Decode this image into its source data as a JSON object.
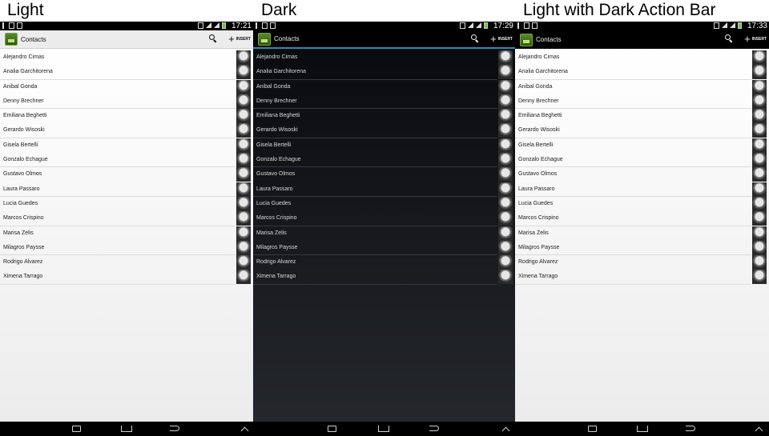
{
  "panels": [
    {
      "caption": "Light",
      "theme": "light",
      "status_time": "17:21",
      "app_title": "Contacts",
      "insert_label": "INSERT",
      "search_icon": "search-icon",
      "contacts": [
        "Alejandro Cimas",
        "Analia Garchitorena",
        "Anibal Gonda",
        "Denny Brechner",
        "Emiliana Beghetti",
        "Gerardo Wisoski",
        "Gisela Bertelli",
        "Gonzalo Echague",
        "Gustavo Olmos",
        "Laura Passaro",
        "Lucia Guedes",
        "Marcos Crispino",
        "Marisa Zelis",
        "Milagros Paysse",
        "Rodrigo Alvarez",
        "Ximena Tarrago"
      ]
    },
    {
      "caption": "Dark",
      "theme": "dark",
      "status_time": "17:29",
      "app_title": "Contacts",
      "insert_label": "INSERT",
      "search_icon": "search-icon",
      "contacts": [
        "Alejandro Cimas",
        "Analia Garchitorena",
        "Anibal Gonda",
        "Denny Brechner",
        "Emiliana Beghetti",
        "Gerardo Wisoski",
        "Gisela Bertelli",
        "Gonzalo Echague",
        "Gustavo Olmos",
        "Laura Passaro",
        "Lucia Guedes",
        "Marcos Crispino",
        "Marisa Zelis",
        "Milagros Paysse",
        "Rodrigo Alvarez",
        "Ximena Tarrago"
      ]
    },
    {
      "caption": "Light with Dark Action Bar",
      "theme": "mixed",
      "status_time": "17:33",
      "app_title": "Contacts",
      "insert_label": "INSERT",
      "search_icon": "search-icon",
      "contacts": [
        "Alejandro Cimas",
        "Analia Garchitorena",
        "Anibal Gonda",
        "Denny Brechner",
        "Emiliana Beghetti",
        "Gerardo Wisoski",
        "Gisela Bertelli",
        "Gonzalo Echague",
        "Gustavo Olmos",
        "Laura Passaro",
        "Lucia Guedes",
        "Marcos Crispino",
        "Marisa Zelis",
        "Milagros Paysse",
        "Rodrigo Alvarez",
        "Ximena Tarrago"
      ]
    }
  ],
  "colors": {
    "holo_blue": "#2b8bb6",
    "battery_green": "#6cc644"
  }
}
